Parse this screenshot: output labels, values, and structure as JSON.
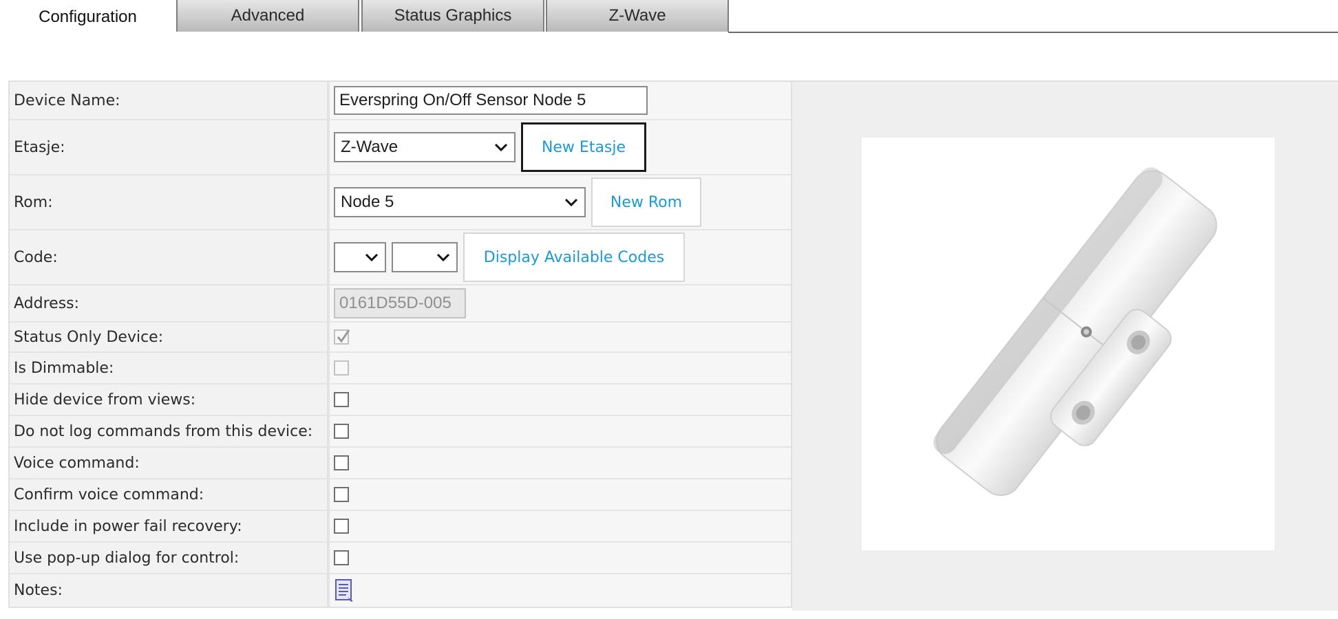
{
  "tabs": [
    {
      "label": "Configuration",
      "active": true
    },
    {
      "label": "Advanced",
      "active": false
    },
    {
      "label": "Status Graphics",
      "active": false
    },
    {
      "label": "Z-Wave",
      "active": false
    }
  ],
  "form": {
    "device_name": {
      "label": "Device Name:",
      "value": "Everspring On/Off Sensor Node 5"
    },
    "etasje": {
      "label": "Etasje:",
      "selected": "Z-Wave",
      "button": "New Etasje"
    },
    "rom": {
      "label": "Rom:",
      "selected": "Node 5",
      "button": "New Rom"
    },
    "code": {
      "label": "Code:",
      "selected_1": "",
      "selected_2": "",
      "button": "Display Available Codes"
    },
    "address": {
      "label": "Address:",
      "value": "0161D55D-005"
    },
    "status_only": {
      "label": "Status Only Device:",
      "checked": true,
      "disabled": true
    },
    "is_dimmable": {
      "label": "Is Dimmable:",
      "checked": false,
      "disabled": true
    },
    "hide_device": {
      "label": "Hide device from views:",
      "checked": false
    },
    "no_log": {
      "label": "Do not log commands from this device:",
      "checked": false
    },
    "voice_command": {
      "label": "Voice command:",
      "checked": false
    },
    "confirm_voice": {
      "label": "Confirm voice command:",
      "checked": false
    },
    "power_fail": {
      "label": "Include in power fail recovery:",
      "checked": false
    },
    "popup_dialog": {
      "label": "Use pop-up dialog for control:",
      "checked": false
    },
    "notes": {
      "label": "Notes:",
      "icon": "notes-icon"
    }
  },
  "colors": {
    "link_blue": "#1a9ad6",
    "label_bg": "#f2f2f2",
    "panel_bg": "#efefef"
  }
}
